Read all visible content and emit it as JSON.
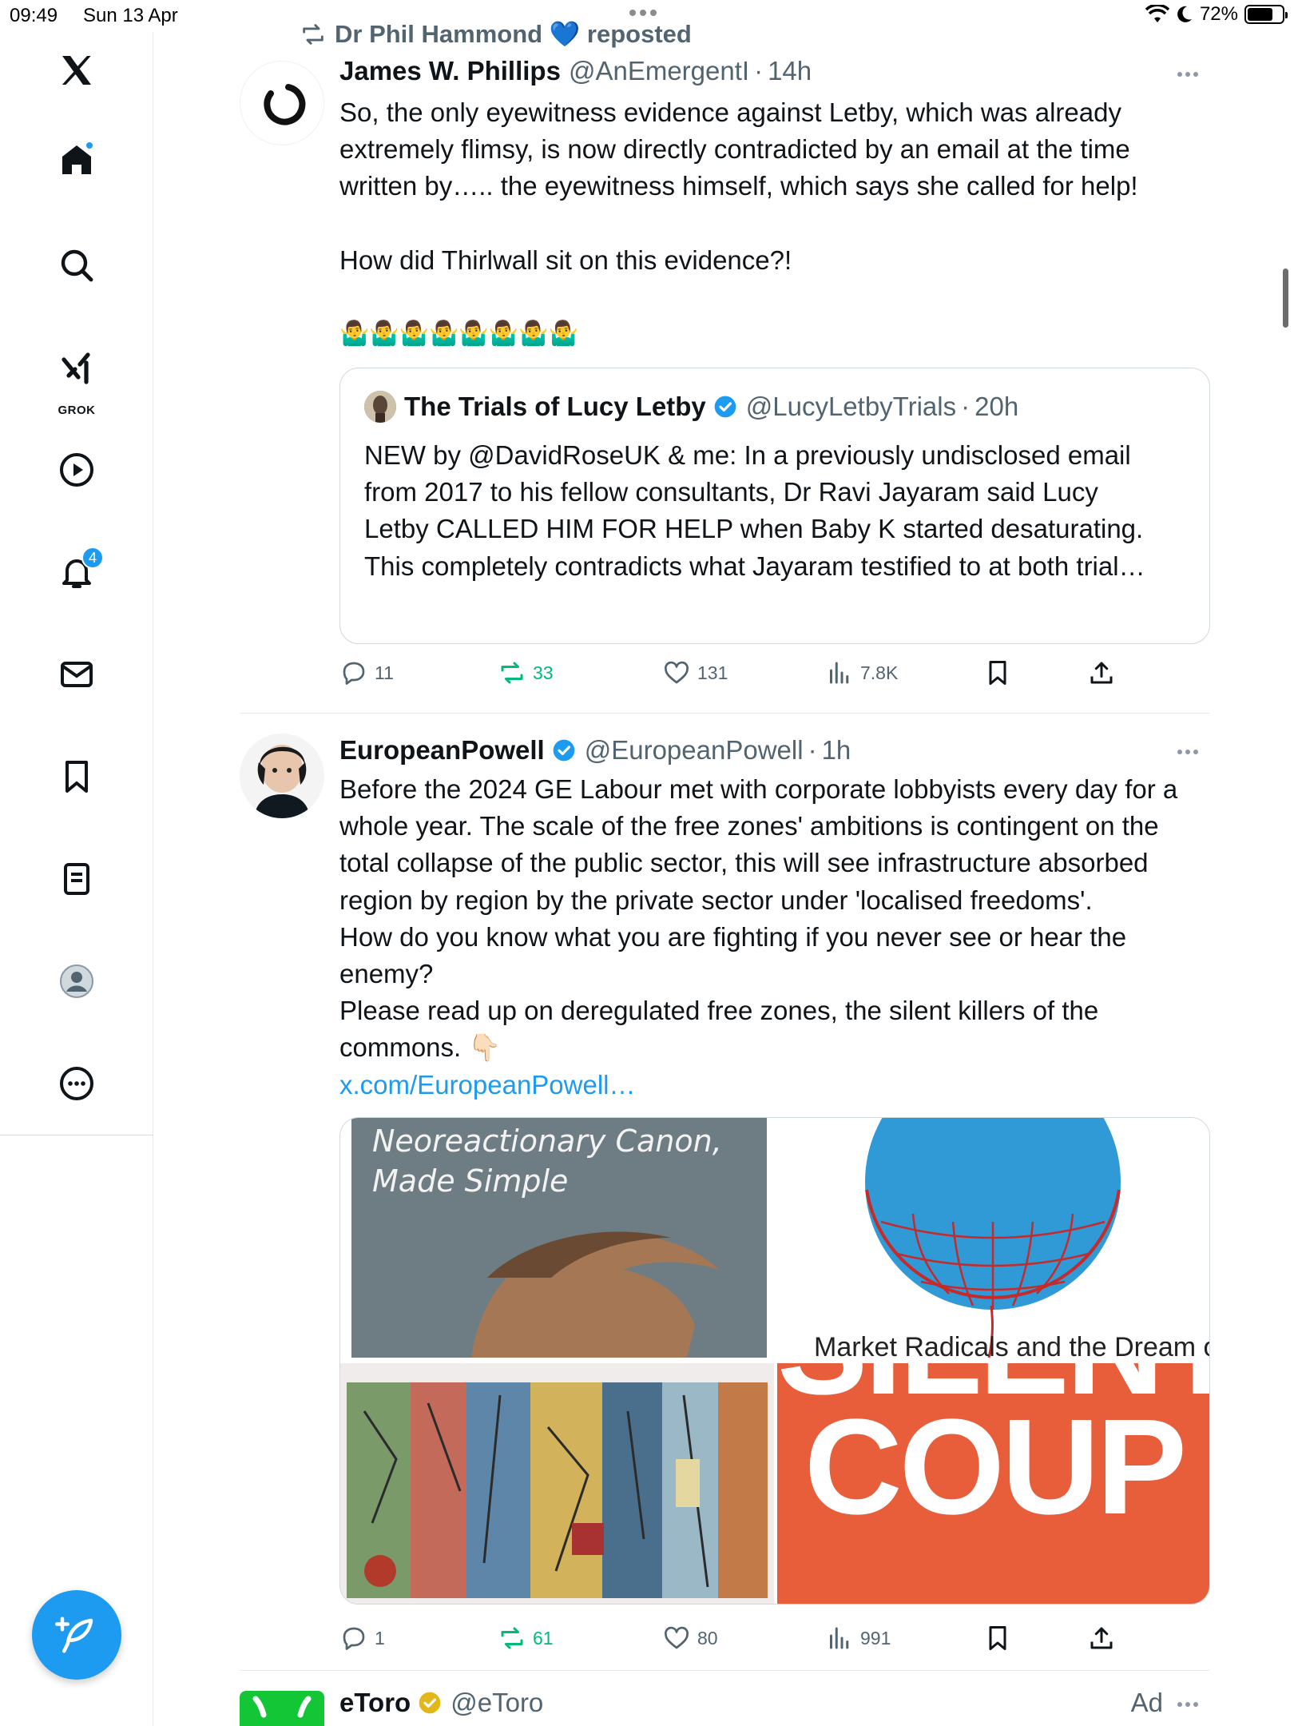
{
  "status_bar": {
    "time": "09:49",
    "date": "Sun 13 Apr",
    "battery": "72%"
  },
  "sidebar": {
    "grok_label": "GROK",
    "notifications_count": "4",
    "items": [
      "home-icon",
      "search-icon",
      "grok-icon",
      "video-icon",
      "notifications-icon",
      "messages-icon",
      "bookmarks-icon",
      "lists-icon",
      "profile-icon",
      "more-icon"
    ]
  },
  "feed": {
    "tweet1": {
      "repost_label": "Dr Phil Hammond 💙 reposted",
      "author_name": "James W. Phillips",
      "author_handle": "@AnEmergentI",
      "time": "14h",
      "text_lines": [
        "So, the only eyewitness evidence against Letby, which was already",
        "extremely flimsy, is now directly contradicted by an email at the time",
        "written by….. the eyewitness himself, which says she called for help!",
        "",
        "How did Thirlwall sit on this evidence?!",
        "",
        "🤷‍♂️🤷‍♂️🤷‍♂️🤷‍♂️🤷‍♂️🤷‍♂️🤷‍♂️🤷‍♂️"
      ],
      "quote": {
        "author_name": "The Trials of Lucy Letby",
        "author_handle": "@LucyLetbyTrials",
        "time": "20h",
        "text_lines": [
          "NEW by @DavidRoseUK & me: In a previously undisclosed email",
          "from 2017 to his fellow consultants, Dr Ravi Jayaram said Lucy",
          "Letby CALLED HIM FOR HELP when Baby K started desaturating.",
          "",
          "This completely contradicts what Jayaram testified to at both trial…"
        ]
      },
      "replies": "11",
      "reposts": "33",
      "likes": "131",
      "views": "7.8K"
    },
    "tweet2": {
      "author_name": "EuropeanPowell",
      "author_handle": "@EuropeanPowell",
      "time": "1h",
      "text_lines": [
        "Before the 2024 GE Labour met with corporate lobbyists every day for a",
        "whole year. The scale of the free zones' ambitions is contingent on the",
        "total collapse of the public sector, this will see infrastructure absorbed",
        "region by region by the private sector under 'localised freedoms'.",
        "How do you know what you are fighting if you never see or hear the",
        "enemy?",
        "Please read up on deregulated free zones, the silent killers of the",
        "commons. 👇🏻"
      ],
      "link": "x.com/EuropeanPowell…",
      "media": [
        {
          "caption": "Neoreactionary Canon,\nMade Simple"
        },
        {
          "caption": "Market Radicals and the Dream of"
        },
        {
          "caption": ""
        },
        {
          "caption": "SILENT COUP"
        }
      ],
      "replies": "1",
      "reposts": "61",
      "likes": "80",
      "views": "991"
    },
    "tweet3": {
      "author_name": "eToro",
      "author_handle": "@eToro",
      "ad_label": "Ad"
    }
  },
  "colors": {
    "accent": "#1d9bf0",
    "repost_green": "#00ba7c",
    "secondary_text": "#536471"
  }
}
